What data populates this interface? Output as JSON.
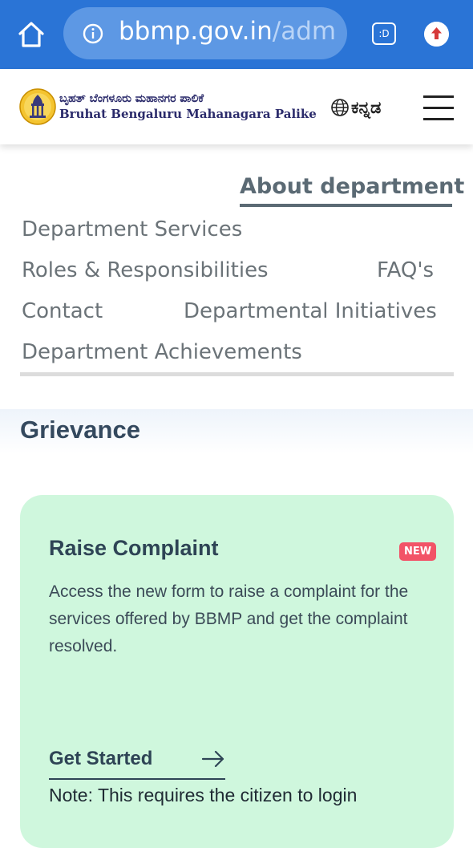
{
  "browser": {
    "url_domain": "bbmp.gov.in",
    "url_path": "/adm",
    "tab_switcher_label": ":D",
    "home_icon": "home-icon",
    "info_icon": "info-icon",
    "update_icon": "update-arrow-icon"
  },
  "header": {
    "logo_kannada": "ಬೃಹತ್ ಬೆಂಗಳೂರು ಮಹಾನಗರ ಪಾಲಿಕೆ",
    "logo_english": "Bruhat Bengaluru Mahanagara Palike",
    "language_label": "ಕನ್ನಡ",
    "language_icon": "globe-icon",
    "menu_icon": "hamburger-menu-icon"
  },
  "dept_nav": {
    "active": "About department",
    "links": {
      "services": "Department Services",
      "roles": "Roles & Responsibilities",
      "faqs": "FAQ's",
      "contact": "Contact",
      "initiatives": "Departmental Initiatives",
      "achievements": "Department Achievements"
    }
  },
  "grievance": {
    "title": "Grievance",
    "card": {
      "title": "Raise Complaint",
      "badge": "NEW",
      "description": "Access the new form to raise a complaint for the services offered by BBMP and get the complaint resolved.",
      "cta": "Get Started",
      "cta_icon": "arrow-right-icon",
      "note": "Note: This requires the citizen to login"
    }
  },
  "colors": {
    "chrome_blue": "#2a74d6",
    "card_green": "#cff7dd",
    "badge_red": "#f25367",
    "heading_dark": "#34495e",
    "nav_gray": "#6b7378"
  }
}
